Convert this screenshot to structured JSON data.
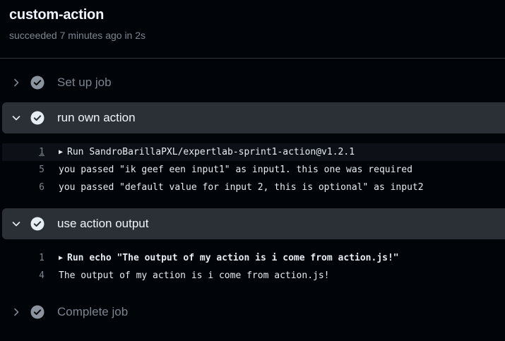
{
  "job": {
    "title": "custom-action",
    "status": "succeeded 7 minutes ago in 2s"
  },
  "steps": [
    {
      "label": "Set up job",
      "state": "collapsed"
    },
    {
      "label": "run own action",
      "state": "expanded"
    },
    {
      "label": "use action output",
      "state": "expanded"
    },
    {
      "label": "Complete job",
      "state": "collapsed"
    }
  ],
  "logs": {
    "run_own_action": [
      {
        "num": "1",
        "text": "Run SandroBarillaPXL/expertlab-sprint1-action@v1.2.1"
      },
      {
        "num": "5",
        "text": "you passed \"ik geef een input1\" as input1. this one was required"
      },
      {
        "num": "6",
        "text": "you passed \"default value for input 2, this is optional\" as input2"
      }
    ],
    "use_action_output": [
      {
        "num": "1",
        "text": "Run echo \"The output of my action is i come from action.js!\""
      },
      {
        "num": "4",
        "text": "The output of my action is i come from action.js!"
      }
    ]
  },
  "icons": {
    "check": "check-circle-fill-icon",
    "chevron_right": "chevron-right-icon",
    "chevron_down": "chevron-down-icon",
    "group": "triangle-right-icon"
  },
  "colors": {
    "background": "#010409",
    "expanded_step_bg": "#2b2f36",
    "muted": "#7d8590",
    "check": "#8b949e"
  }
}
